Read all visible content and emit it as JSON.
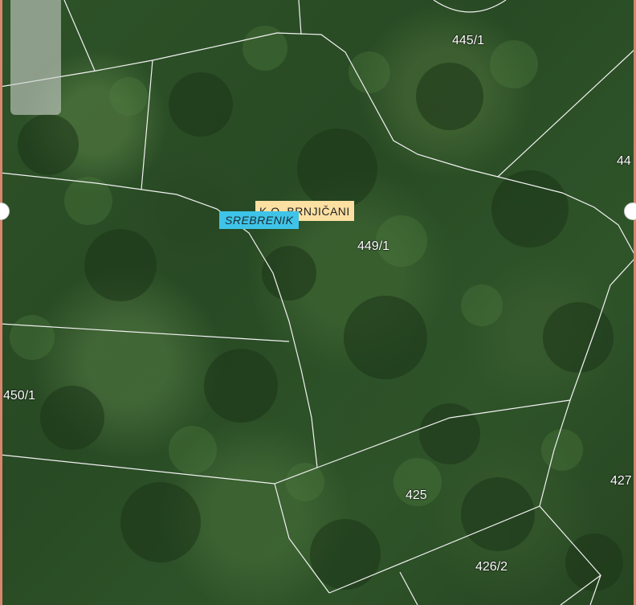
{
  "map": {
    "cadastral_municipality_label": "K.O. BRNJIČANI",
    "municipality_label": "SREBRENIK",
    "parcels": {
      "p445_1": "445/1",
      "p44_partial": "44",
      "p449_1": "449/1",
      "p450_1": "450/1",
      "p425": "425",
      "p427_partial": "427",
      "p426_2": "426/2"
    },
    "colors": {
      "parcel_line": "#f2f2f2",
      "municipality_badge": "#3ec4e8",
      "cadastral_badge": "#fbe0a2",
      "frame_edge": "#d9866e"
    }
  }
}
